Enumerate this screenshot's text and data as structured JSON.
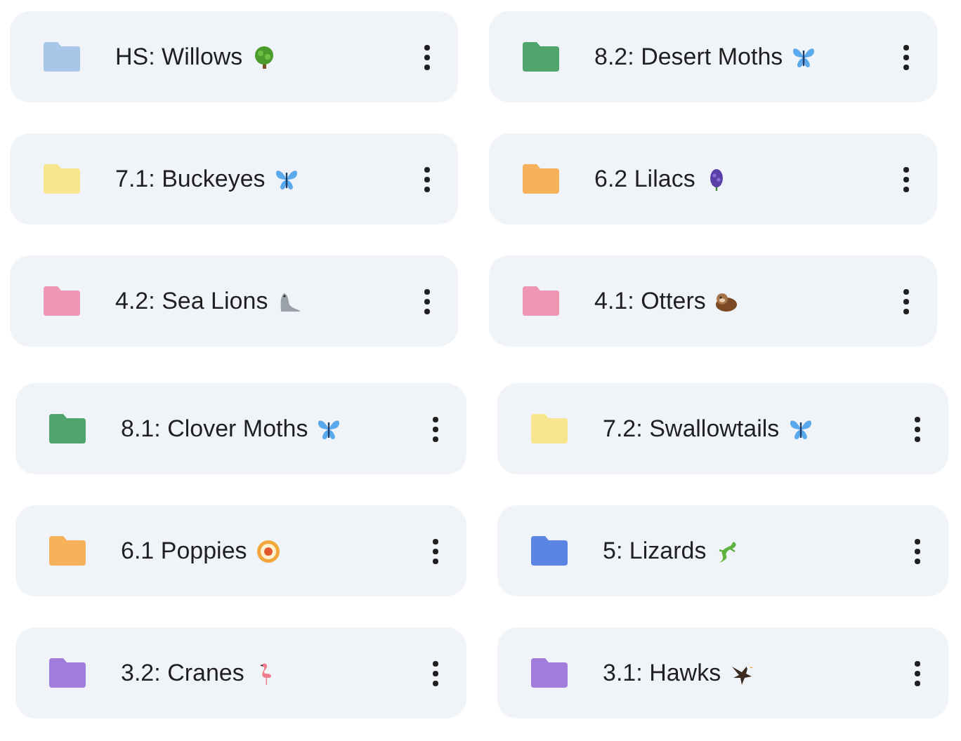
{
  "sections": [
    {
      "folders": [
        {
          "name": "HS: Willows",
          "color": "#a8c7e8",
          "kind": "tree"
        },
        {
          "name": "8.2: Desert Moths",
          "color": "#4fa56b",
          "kind": "butterfly"
        },
        {
          "name": "7.1: Buckeyes",
          "color": "#f8e68e",
          "kind": "butterfly"
        },
        {
          "name": "6.2 Lilacs",
          "color": "#f5b25a",
          "kind": "hyacinth"
        },
        {
          "name": "4.2: Sea Lions",
          "color": "#ee96b2",
          "kind": "seal"
        },
        {
          "name": "4.1: Otters",
          "color": "#ee96b2",
          "kind": "otter"
        }
      ]
    },
    {
      "folders": [
        {
          "name": "8.1: Clover Moths",
          "color": "#4fa56b",
          "kind": "butterfly"
        },
        {
          "name": "7.2: Swallowtails",
          "color": "#f8e68e",
          "kind": "butterfly"
        },
        {
          "name": "6.1 Poppies",
          "color": "#f5b25a",
          "kind": "rosette"
        },
        {
          "name": "5: Lizards",
          "color": "#5b85e3",
          "kind": "lizard"
        },
        {
          "name": "3.2: Cranes",
          "color": "#a07ddc",
          "kind": "flamingo"
        },
        {
          "name": "3.1: Hawks",
          "color": "#a07ddc",
          "kind": "eagle"
        }
      ]
    }
  ]
}
